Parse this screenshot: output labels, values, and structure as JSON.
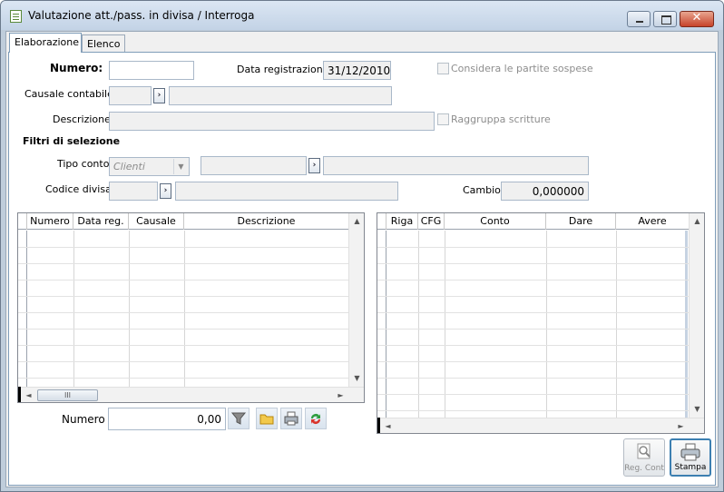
{
  "window": {
    "title": "Valutazione att./pass. in divisa / Interroga"
  },
  "tabs": [
    {
      "label": "Elaborazione"
    },
    {
      "label": "Elenco"
    }
  ],
  "form": {
    "numero_label": "Numero:",
    "numero_value": "",
    "data_reg_label": "Data registrazione:",
    "data_reg_value": "31/12/2010",
    "partite_sospese_label": "Considera le partite sospese",
    "causale_label": "Causale contabile:",
    "causale_code": "",
    "causale_desc": "",
    "descrizione_label": "Descrizione:",
    "descrizione_value": "",
    "raggruppa_label": "Raggruppa scritture",
    "filtri_title": "Filtri di selezione",
    "tipo_conto_label": "Tipo conto:",
    "tipo_conto_value": "Clienti",
    "codice_divisa_label": "Codice divisa:",
    "cambio_label": "Cambio:",
    "cambio_value": "0,000000"
  },
  "left_grid": {
    "columns": [
      "Numero",
      "Data reg.",
      "Causale",
      "Descrizione"
    ]
  },
  "right_grid": {
    "columns": [
      "Riga",
      "CFG",
      "Conto",
      "Dare",
      "Avere"
    ]
  },
  "footer": {
    "numero_label": "Numero",
    "numero_value": "0,00",
    "reg_cont_label": "Reg. Cont",
    "stampa_label": "Stampa"
  },
  "icons": [
    "filter-icon",
    "folder-icon",
    "printer-icon",
    "refresh-icon",
    "zoom-icon",
    "print-big-icon"
  ]
}
